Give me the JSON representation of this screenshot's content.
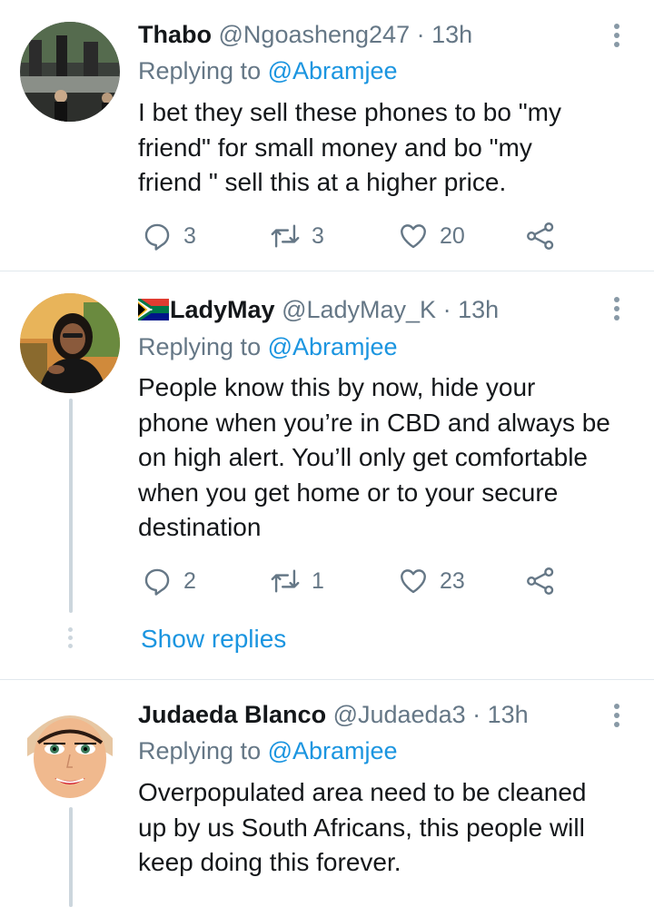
{
  "tweets": [
    {
      "name": "Thabo",
      "handle": "@Ngoasheng247",
      "separator": "·",
      "time": "13h",
      "replying_label": "Replying to",
      "replying_to": "@Abramjee",
      "text_lines": [
        "I bet they sell these phones to bo \"my",
        "friend\" for small money and bo \"my",
        "friend \" sell this at a higher price."
      ],
      "replies": "3",
      "retweets": "3",
      "likes": "20"
    },
    {
      "name": "LadyMay",
      "name_flag": "south-africa-flag",
      "handle": "@LadyMay_K",
      "separator": "·",
      "time": "13h",
      "replying_label": "Replying to",
      "replying_to": "@Abramjee",
      "text_lines": [
        "People know this by now, hide your",
        "phone when you’re in CBD and always be",
        "on high alert. You’ll only get comfortable",
        "when you get home or to your secure",
        "destination"
      ],
      "replies": "2",
      "retweets": "1",
      "likes": "23",
      "show_replies": "Show replies"
    },
    {
      "name": "Judaeda Blanco",
      "handle": "@Judaeda3",
      "separator": "·",
      "time": "13h",
      "replying_label": "Replying to",
      "replying_to": "@Abramjee",
      "text_lines": [
        "Overpopulated area need to be cleaned",
        "up by us South Africans, this people will",
        "keep doing this forever."
      ]
    }
  ],
  "icons": {
    "reply": "reply-icon",
    "retweet": "retweet-icon",
    "like": "heart-icon",
    "share": "share-icon",
    "more": "more-options-icon"
  },
  "colors": {
    "text": "#14171a",
    "secondary": "#657786",
    "link": "#1b95e0",
    "divider": "#e1e8ed",
    "thread": "#ccd6dd"
  }
}
